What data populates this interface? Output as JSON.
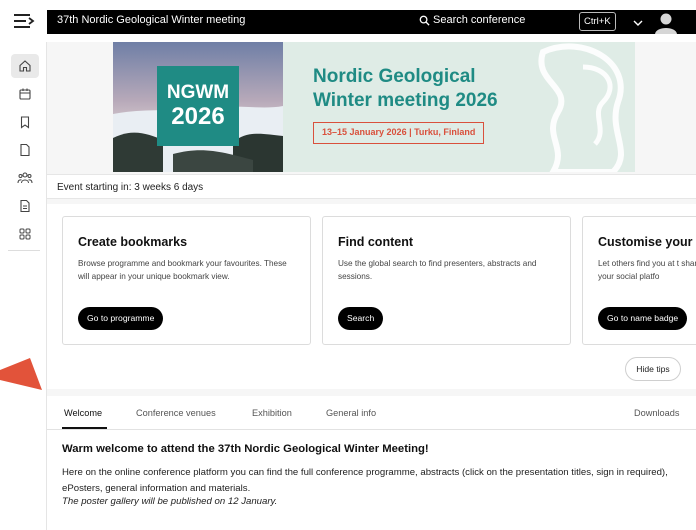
{
  "app": {
    "title": "37th Nordic Geological Winter meeting",
    "search_placeholder": "Search conference",
    "shortcut": "Ctrl+K"
  },
  "sidebar": {
    "items": [
      {
        "icon": "home-icon"
      },
      {
        "icon": "calendar-icon"
      },
      {
        "icon": "bookmark-icon"
      },
      {
        "icon": "file-icon"
      },
      {
        "icon": "people-icon"
      },
      {
        "icon": "document-icon"
      },
      {
        "icon": "apps-icon"
      }
    ]
  },
  "banner": {
    "logo_line1": "NGWM",
    "logo_line2": "2026",
    "headline_line1": "Nordic Geological",
    "headline_line2": "Winter meeting 2026",
    "dates": "13–15 January 2026 | Turku, Finland"
  },
  "event": {
    "countdown": "Event starting in: 3 weeks 6 days"
  },
  "tips": {
    "cards": [
      {
        "title": "Create bookmarks",
        "text": "Browse programme and bookmark your favourites. These will appear in your unique bookmark view.",
        "button": "Go to programme"
      },
      {
        "title": "Find content",
        "text": "Use the global search to find presenters, abstracts and sessions.",
        "button": "Search"
      },
      {
        "title": "Customise your",
        "text": "Let others find you at t share your social platfo",
        "button": "Go to name badge"
      }
    ],
    "hide_label": "Hide tips"
  },
  "tabs": [
    "Welcome",
    "Conference venues",
    "Exhibition",
    "General info",
    "Downloads"
  ],
  "welcome": {
    "heading": "Warm welcome to attend the 37th Nordic Geological Winter Meeting!",
    "paragraph": "Here on the online conference platform you can find the full conference programme, abstracts (click on the presentation titles, sign in required), ePosters, general information and materials.",
    "note": "The poster gallery will be published on 12 January."
  },
  "colors": {
    "brand_teal": "#1f8b84",
    "banner_bg": "#dfece6",
    "dates_red": "#d9503c",
    "arrow": "#e2533a"
  }
}
